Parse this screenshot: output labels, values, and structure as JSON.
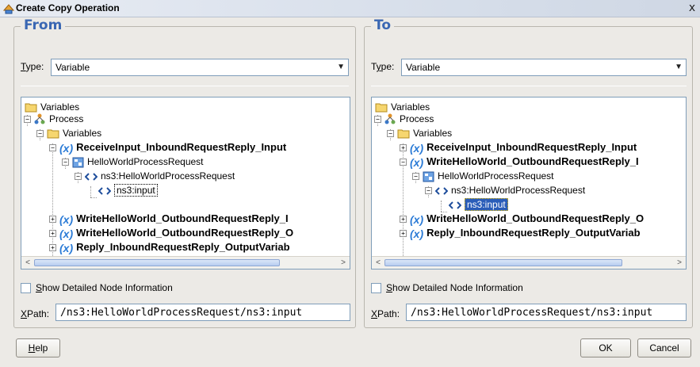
{
  "window": {
    "title": "Create Copy Operation",
    "close_glyph": "x"
  },
  "from": {
    "legend": "From",
    "type_label_prefix": "T",
    "type_label_rest": "ype:",
    "type_value": "Variable",
    "tree": {
      "root": "Variables",
      "process": "Process",
      "variables": "Variables",
      "receive_input": "ReceiveInput_InboundRequestReply_Input",
      "hello_request": "HelloWorldProcessRequest",
      "ns3_request": "ns3:HelloWorldProcessRequest",
      "ns3_input": "ns3:input",
      "write_hello": "WriteHelloWorld_OutboundRequestReply_I",
      "write_hello_2": "WriteHelloWorld_OutboundRequestReply_O",
      "reply": "Reply_InboundRequestReply_OutputVariab",
      "var_prefix": "(x)"
    },
    "show_details_prefix": "S",
    "show_details_rest": "how Detailed Node Information",
    "xpath_label_prefix": "X",
    "xpath_label_rest": "Path:",
    "xpath_value": "/ns3:HelloWorldProcessRequest/ns3:input"
  },
  "to": {
    "legend": "To",
    "type_label_prefix": "y",
    "type_label_a": "T",
    "type_label_rest": "pe:",
    "type_value": "Variable",
    "tree": {
      "root": "Variables",
      "process": "Process",
      "variables": "Variables",
      "receive_input": "ReceiveInput_InboundRequestReply_Input",
      "write_hello": "WriteHelloWorld_OutboundRequestReply_I",
      "hello_request": "HelloWorldProcessRequest",
      "ns3_request": "ns3:HelloWorldProcessRequest",
      "ns3_input": "ns3:input",
      "write_hello_2": "WriteHelloWorld_OutboundRequestReply_O",
      "reply": "Reply_InboundRequestReply_OutputVariab",
      "var_prefix": "(x)"
    },
    "show_details_prefix": "S",
    "show_details_rest": "how Detailed Node Information",
    "xpath_label_prefix": "X",
    "xpath_label_rest": "Path:",
    "xpath_value": "/ns3:HelloWorldProcessRequest/ns3:input"
  },
  "buttons": {
    "help_prefix": "H",
    "help_rest": "elp",
    "ok": "OK",
    "cancel": "Cancel"
  },
  "colors": {
    "legend": "#3a67b3",
    "variable_icon": "#2b7bd6",
    "selection": "#2a5db9"
  },
  "icons": {
    "window": "copy-operation-icon",
    "folder": "folder-icon",
    "process": "process-icon",
    "message_part": "message-part-icon",
    "element": "element-icon"
  }
}
